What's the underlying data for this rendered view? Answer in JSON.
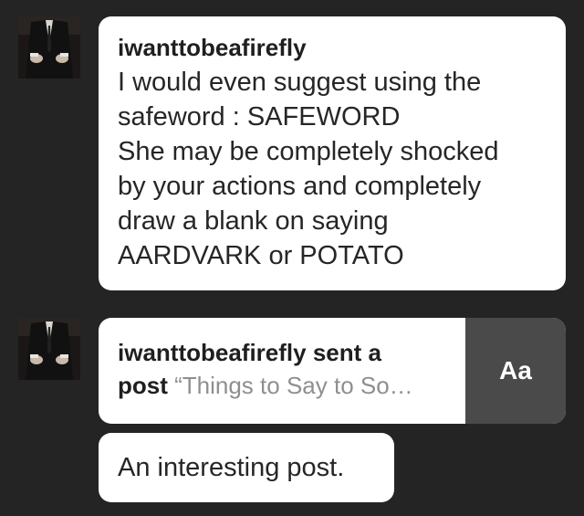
{
  "messages": [
    {
      "username": "iwanttobeafirefly",
      "text": "I would even suggest using the\nsafeword : SAFEWORD\nShe may be completely shocked\nby your actions and completely\ndraw a blank on saying\nAARDVARK or POTATO"
    }
  ],
  "shared_post": {
    "sender_line": "iwanttobeafirefly sent a",
    "post_word": "post",
    "post_title": " “Things to Say to So…",
    "thumbnail_text": "Aa"
  },
  "followup": {
    "text": "An interesting post."
  },
  "avatar": {
    "icon": "suited-figure-avatar"
  }
}
